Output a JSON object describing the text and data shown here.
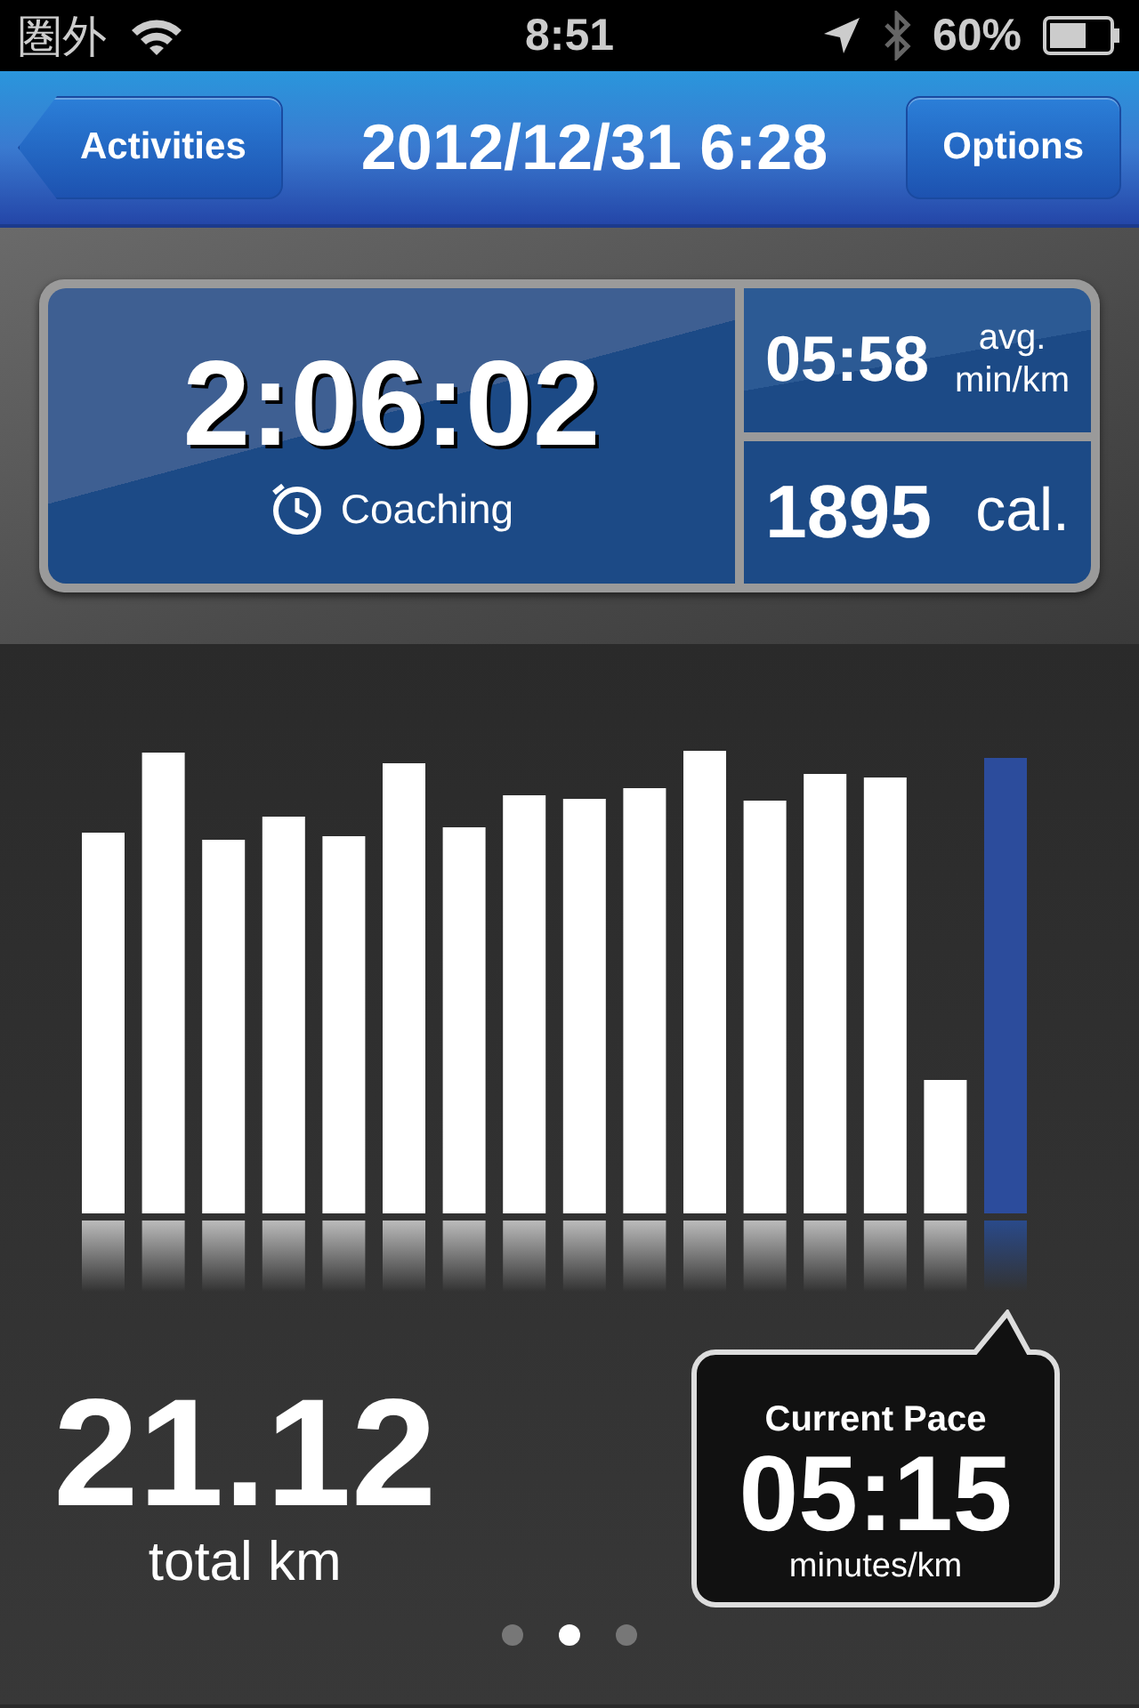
{
  "status_bar": {
    "carrier": "圏外",
    "time": "8:51",
    "battery": "60%"
  },
  "nav_bar": {
    "back_button": "Activities",
    "title": "2012/12/31 6:28",
    "options_button": "Options"
  },
  "summary": {
    "duration": "2:06:02",
    "coaching": "Coaching",
    "pace": "05:58",
    "pace_unit_1": "avg.",
    "pace_unit_2": "min/km",
    "calories": "1895",
    "calories_unit": "cal."
  },
  "distance": {
    "value": "21.12",
    "unit": "total km"
  },
  "current_pace": {
    "label": "Current Pace",
    "value": "05:15",
    "unit": "minutes/km"
  },
  "pages": [
    {
      "selected": false
    },
    {
      "selected": true
    },
    {
      "selected": false
    }
  ]
}
